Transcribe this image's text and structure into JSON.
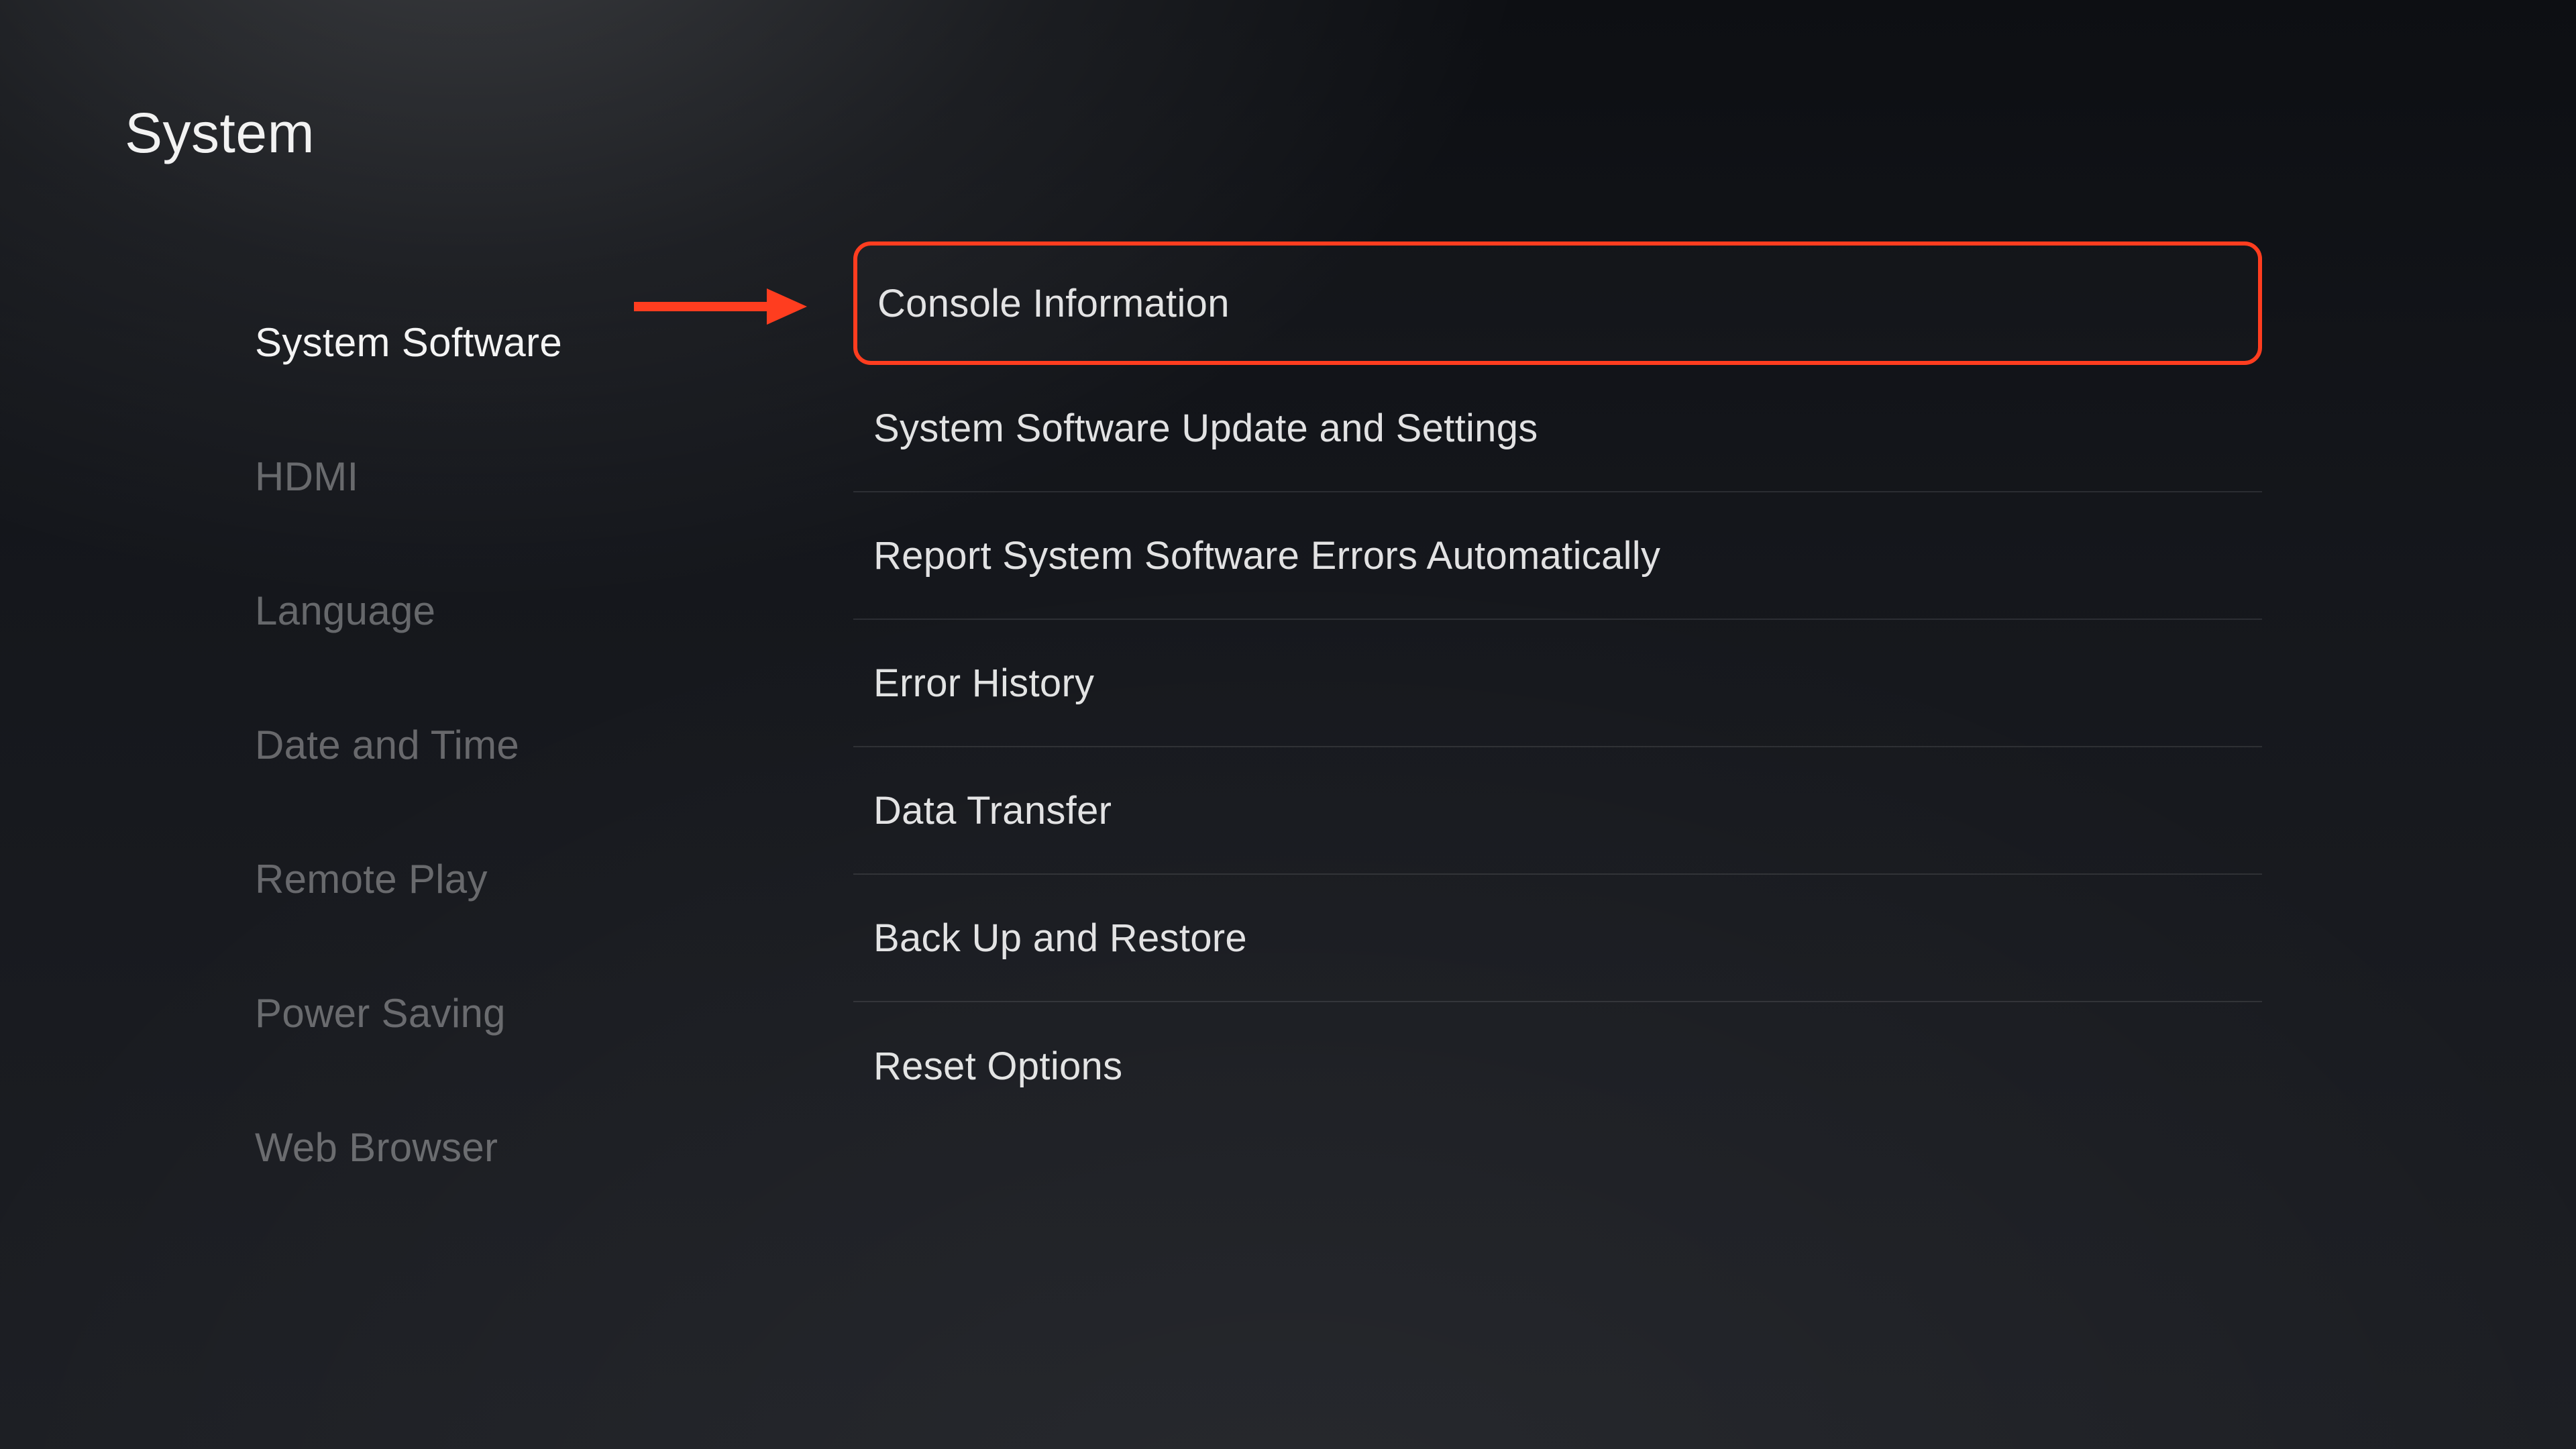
{
  "page": {
    "title": "System"
  },
  "sidebar": {
    "items": [
      {
        "label": "System Software",
        "active": true
      },
      {
        "label": "HDMI",
        "active": false
      },
      {
        "label": "Language",
        "active": false
      },
      {
        "label": "Date and Time",
        "active": false
      },
      {
        "label": "Remote Play",
        "active": false
      },
      {
        "label": "Power Saving",
        "active": false
      },
      {
        "label": "Web Browser",
        "active": false
      }
    ]
  },
  "content": {
    "items": [
      {
        "label": "Console Information",
        "highlighted": true
      },
      {
        "label": "System Software Update and Settings",
        "highlighted": false
      },
      {
        "label": "Report System Software Errors Automatically",
        "highlighted": false
      },
      {
        "label": "Error History",
        "highlighted": false
      },
      {
        "label": "Data Transfer",
        "highlighted": false
      },
      {
        "label": "Back Up and Restore",
        "highlighted": false
      },
      {
        "label": "Reset Options",
        "highlighted": false
      }
    ]
  },
  "annotation": {
    "arrow_color": "#ff3d1f"
  }
}
